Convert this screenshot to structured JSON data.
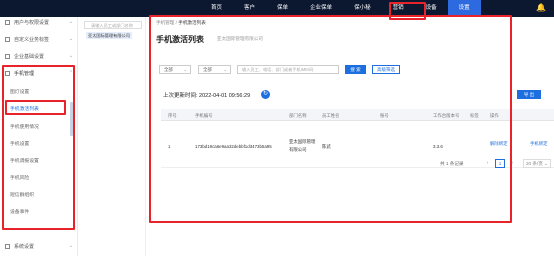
{
  "topnav": {
    "items": [
      "首页",
      "客户",
      "保单",
      "企业保单",
      "保小秘",
      "营销",
      "设备",
      "设置"
    ],
    "active": "设置"
  },
  "sidebar": {
    "groups": [
      {
        "label": "用户与权限设置"
      },
      {
        "label": "自定义业务标签"
      },
      {
        "label": "企业基础设置"
      },
      {
        "label": "手机管理"
      }
    ],
    "subitems": [
      "图灯设置",
      "手机激活列表",
      "手机使用情况",
      "手机设置",
      "手机调报设置",
      "手机风险",
      "短信群组织",
      "设备事件"
    ],
    "bottom": {
      "label": "系统设置"
    }
  },
  "tree": {
    "search_placeholder": "请输入员工或部门名称",
    "node": "亚太国际管理有限公司"
  },
  "main": {
    "breadcrumb": {
      "parent": "手机管理",
      "current": "手机激活列表"
    },
    "title": "手机激活列表",
    "subtitle": "亚太国际管理有限公司",
    "filters": {
      "select1": "全部",
      "select2": "全部",
      "search_placeholder": "输入员工、电话、部门或者手机IMEI码",
      "search_btn": "搜 索",
      "advanced_btn": "高级筛选"
    },
    "export_btn": "导 出",
    "refresh_label": "上次更新时间: 2022-04-01 09:56:29",
    "table": {
      "headers": [
        "序号",
        "手机编号",
        "部门名称",
        "员工姓名",
        "账号",
        "工作台版本号",
        "标签",
        "操作"
      ],
      "row": {
        "index": "1",
        "phone_id": "173bd19ca6e9aa32debbf1d3473b5a95",
        "dept_line1": "亚太国际管理",
        "dept_line2": "有限公司",
        "employee": "陈武",
        "version": "3.3.6",
        "action1": "解除绑定",
        "action2": "手机绑定"
      }
    },
    "pager": {
      "total": "共 1 条记录",
      "page": "1",
      "size": "20 条/页"
    }
  }
}
